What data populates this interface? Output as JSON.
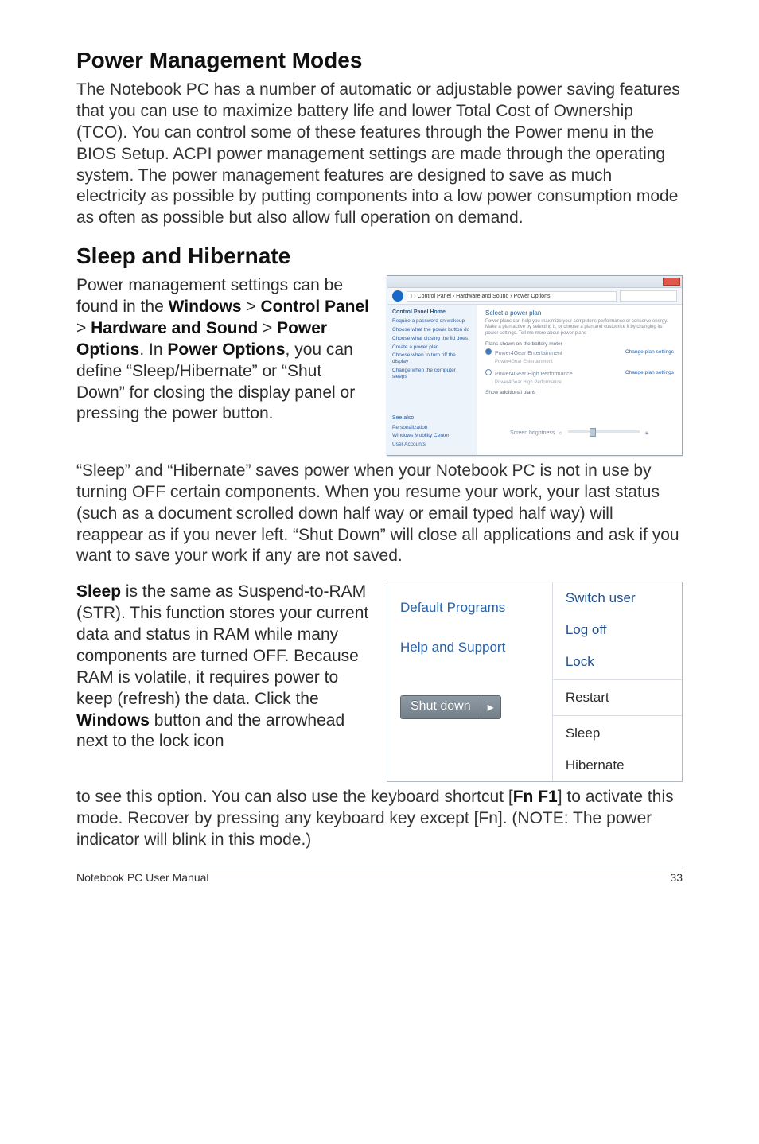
{
  "headings": {
    "h1": "Power Management Modes",
    "h2": "Sleep and Hibernate"
  },
  "para1": "The Notebook PC has a number of automatic or adjustable power saving features that you can use to maximize battery life and lower Total Cost of Ownership (TCO). You can control some of these features through the Power menu in the BIOS Setup. ACPI power management settings are made through the operating system. The power management features are designed to save as much electricity as possible by putting components into a low power consumption mode as often as possible but also allow full operation on demand.",
  "sleep_hib": {
    "p1_a": "Power management settings can be found in the ",
    "p1_b": "Windows",
    "p1_c": " > ",
    "p1_d": "Control Panel",
    "p1_e": " > ",
    "p1_f": "Hardware and Sound",
    "p1_g": " > ",
    "p1_h": "Power Options",
    "p1_i": ". In ",
    "p1_j": "Power Options",
    "p1_k": ", you can define “Sleep/Hibernate” or “Shut Down” for closing the display panel or pressing the power button."
  },
  "para2": "“Sleep” and “Hibernate” saves power when your Notebook PC is not in use by turning OFF certain components. When you resume your work, your last status (such as a document scrolled down half way or email typed half way) will reappear as if you never left. “Shut Down” will close all applications and ask if you want to save your work if any are not saved.",
  "sleep_str": {
    "a": "Sleep",
    "b": " is the same as Suspend-to-RAM (STR). This function stores your current data and status in RAM while many components are turned OFF. Because RAM is volatile, it requires power to keep (refresh) the data. Click the ",
    "c": "Windows",
    "d": " button and the arrowhead next to the lock icon"
  },
  "para3_a": "to see this option. You can also use the keyboard shortcut [",
  "para3_b": "Fn F1",
  "para3_c": "] to activate this mode. Recover by pressing any keyboard key except [Fn]. (NOTE: The power indicator will blink in this mode.)",
  "po_window": {
    "breadcrumb": "‹ ›  Control Panel › Hardware and Sound › Power Options",
    "sidebar_header": "Control Panel Home",
    "sidebar_links": [
      "Require a password on wakeup",
      "Choose what the power button do",
      "Choose what closing the lid does",
      "Create a power plan",
      "Choose when to turn off the display",
      "Change when the computer sleeps"
    ],
    "see_also_label": "See also",
    "see_also_links": [
      "Personalization",
      "Windows Mobility Center",
      "User Accounts"
    ],
    "title": "Select a power plan",
    "desc": "Power plans can help you maximize your computer's performance or conserve energy. Make a plan active by selecting it, or choose a plan and customize it by changing its power settings. Tell me more about power plans",
    "group1": "Plans shown on the battery meter",
    "opt1": "Power4Gear Entertainment",
    "opt1b": "Power4Gear Entertainment",
    "opt2": "Power4Gear High Performance",
    "opt2b": "Power4Gear High Performance",
    "change": "Change plan settings",
    "show_more": "Show additional plans",
    "brightness": "Screen brightness"
  },
  "start_menu": {
    "left": {
      "items": [
        "Default Programs",
        "Help and Support"
      ],
      "shutdown": "Shut down"
    },
    "right": [
      "Switch user",
      "Log off",
      "Lock",
      "Restart",
      "Sleep",
      "Hibernate"
    ]
  },
  "footer": {
    "left": "Notebook PC User Manual",
    "right": "33"
  }
}
